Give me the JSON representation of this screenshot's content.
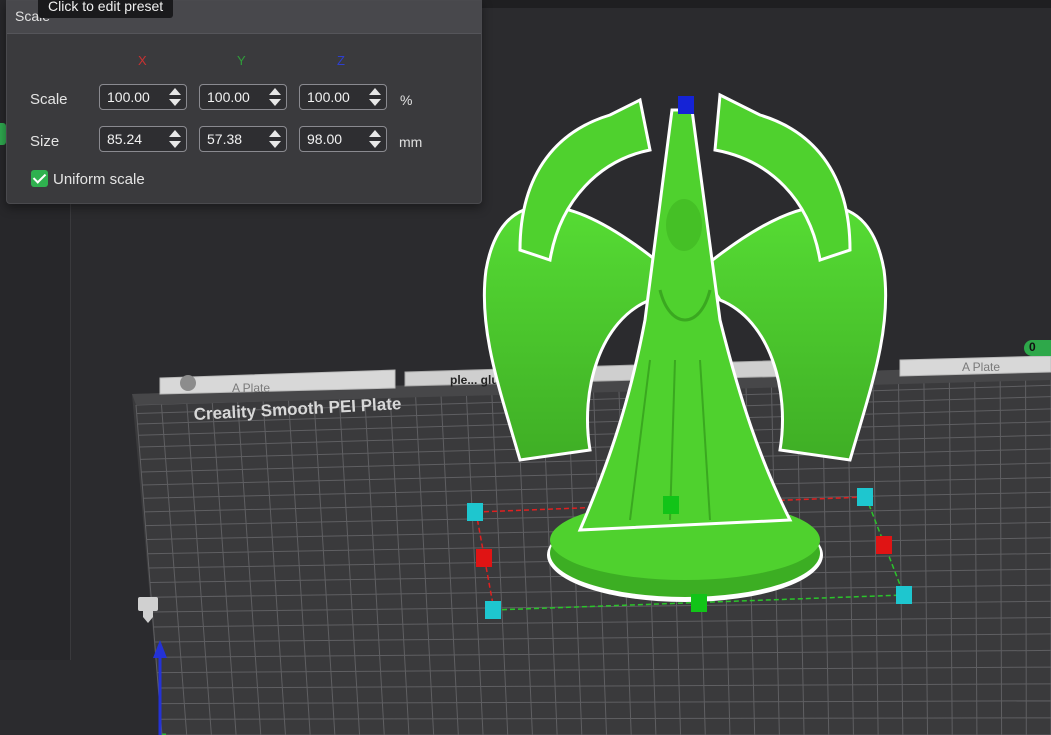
{
  "tooltip": "Click to edit preset",
  "scale_panel": {
    "title": "Scale",
    "axis_labels": {
      "x": "X",
      "y": "Y",
      "z": "Z"
    },
    "axis_colors": {
      "x": "#c83232",
      "y": "#2f9e3a",
      "z": "#2d3fd0"
    },
    "scale_row": {
      "label": "Scale",
      "x": "100.00",
      "y": "100.00",
      "z": "100.00",
      "unit": "%"
    },
    "size_row": {
      "label": "Size",
      "x": "85.24",
      "y": "57.38",
      "z": "98.00",
      "unit": "mm"
    },
    "uniform_scale": {
      "label": "Uniform scale",
      "checked": true
    }
  },
  "plate": {
    "name_left": "A Plate",
    "name_right": "A Plate",
    "tab_text": "ple... glue... int",
    "bed_label": "Creality Smooth PEI Plate",
    "grid_color": "#5f5f62",
    "bed_color": "#3a3a3c"
  },
  "model": {
    "color": "#4fd12e",
    "outline_color": "#ffffff"
  },
  "gizmo": {
    "handle_colors": {
      "corner": "#1ec6cf",
      "x": "#e01414",
      "y": "#12c418",
      "z": "#1523d6"
    }
  },
  "axis_icon": {
    "name": "printer-head-icon"
  }
}
